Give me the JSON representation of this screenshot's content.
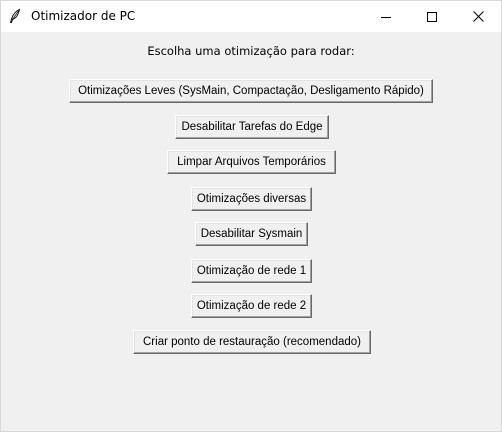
{
  "window": {
    "title": "Otimizador de PC",
    "icon": "feather-icon",
    "controls": {
      "minimize_icon": "minimize-icon",
      "maximize_icon": "maximize-icon",
      "close_icon": "close-icon"
    }
  },
  "main": {
    "prompt": "Escolha uma otimização para rodar:",
    "buttons": [
      {
        "label": "Otimizações Leves (SysMain, Compactação, Desligamento Rápido)"
      },
      {
        "label": "Desabilitar Tarefas do Edge"
      },
      {
        "label": "Limpar Arquivos Temporários"
      },
      {
        "label": "Otimizações diversas"
      },
      {
        "label": "Desabilitar Sysmain"
      },
      {
        "label": "Otimização de rede 1"
      },
      {
        "label": "Otimização de rede 2"
      },
      {
        "label": "Criar ponto de restauração (recomendado)"
      }
    ]
  },
  "colors": {
    "window_bg": "#f0f0f0",
    "titlebar_bg": "#ffffff"
  }
}
